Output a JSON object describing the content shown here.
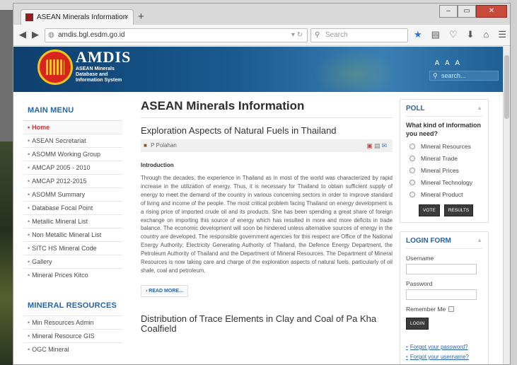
{
  "browser": {
    "tab_title": "ASEAN Minerals Information",
    "tab_close": "×",
    "new_tab": "+",
    "url": "amdis.bgl.esdm.go.id",
    "search_placeholder": "Search",
    "window_buttons": {
      "minimize": "–",
      "maximize": "▭",
      "close": "✕"
    }
  },
  "site": {
    "brand_name": "AMDIS",
    "brand_sub": [
      "ASEAN Minerals",
      "Database and",
      "Information System"
    ],
    "font_sizer": "A A A",
    "search_placeholder": "search..."
  },
  "main_menu": {
    "title": "MAIN MENU",
    "items": [
      "Home",
      "ASEAN Secretariat",
      "ASOMM Working Group",
      "AMCAP 2005 - 2010",
      "AMCAP 2012-2015",
      "ASOMM Summary",
      "Database Focal Point",
      "Metallic Mineral List",
      "Non Metallic Mineral List",
      "SITC HS Mineral Code",
      "Gallery",
      "Mineral Prices Kitco"
    ]
  },
  "mineral_resources": {
    "title": "MINERAL RESOURCES",
    "items": [
      "Min Resources Admin",
      "Mineral Resource GIS",
      "OGC Mineral"
    ]
  },
  "main": {
    "page_title": "ASEAN Minerals Information",
    "article1": {
      "title": "Exploration Aspects of Natural Fuels in Thailand",
      "author": "P Polahan",
      "intro_heading": "Introduction",
      "body": "Through the decades, the experience in Thailand as in most of the world was characterized by rapid increase in the utilization of energy. Thus, it is necessary for Thailand to obtain sufficient supply of energy to meet the demand of the country in various concerning sectors in order to improve standard of living and income of the people. The most critical problem facing Thailand on energy development is a rising price of imported crude oil and its products. She has been spending a great share of foreign exchange on importing this source of energy which has resulted in more and more deficits in trade balance. The economic development will soon be hindered unless alternative sources of energy in the country are developed. The responsible government agencies for this respect are Office of the National Energy Authority; Electricity Generating Authority of Thailand, the Defence Energy Department, the Petroleum Authority of Thailand and the Department of Mineral Resources. The Department of Mineral Resources is now taking care and charge of the exploration aspects of natural fuels, particularly of oil shale, coal and petroleum.",
      "read_more": "› READ MORE..."
    },
    "article2": {
      "title": "Distribution of Trace Elements in Clay and Coal of Pa Kha Coalfield"
    }
  },
  "poll": {
    "title": "POLL",
    "question": "What kind of information you need?",
    "options": [
      "Mineral Resources",
      "Mineral Trade",
      "Mineral Prices",
      "Mineral Technology",
      "Mineral Product"
    ],
    "vote_label": "VOTE",
    "results_label": "RESULTS"
  },
  "login": {
    "title": "LOGIN FORM",
    "username_label": "Username",
    "password_label": "Password",
    "remember_label": "Remember Me",
    "login_label": "LOGIN",
    "forgot_password": "Forgot your password?",
    "forgot_username": "Forgot your username?"
  }
}
